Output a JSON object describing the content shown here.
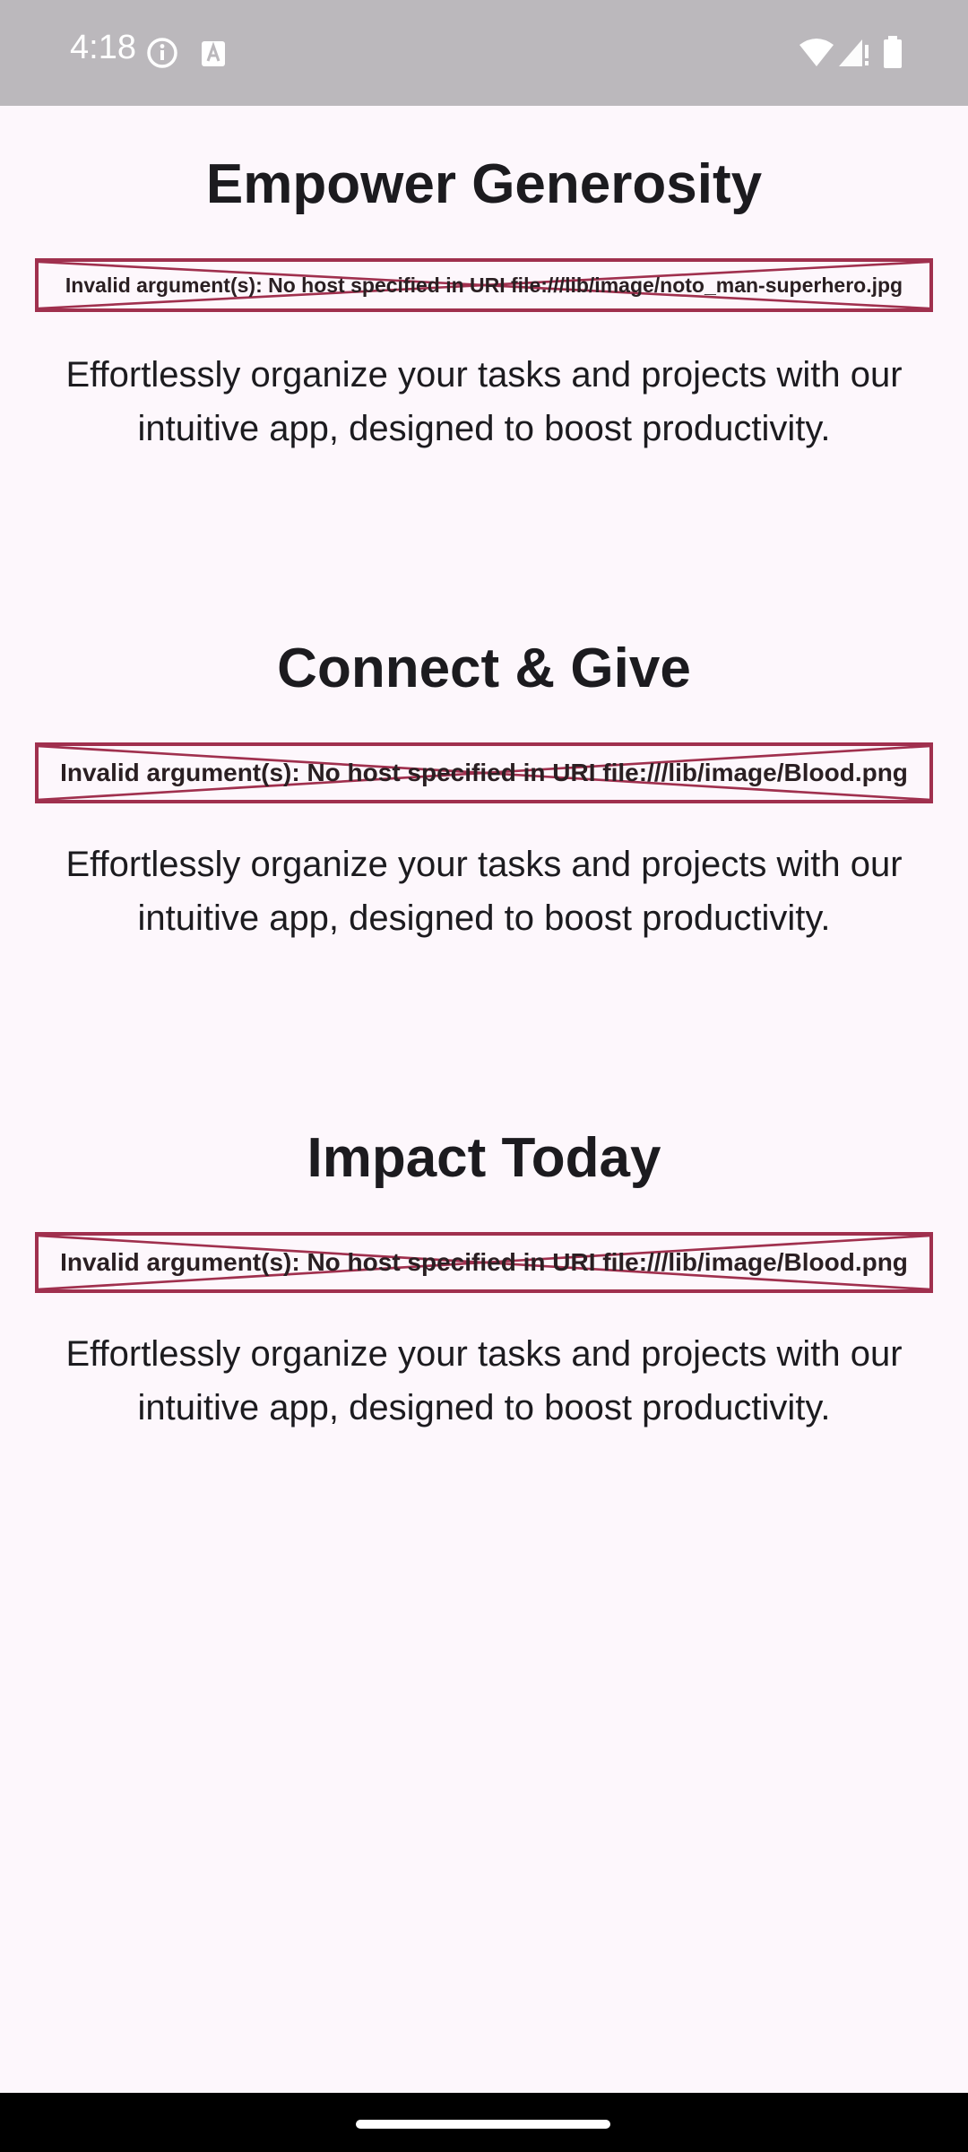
{
  "status_bar": {
    "time": "4:18",
    "icons": [
      "info-icon",
      "text-icon",
      "wifi-icon",
      "signal-icon",
      "battery-icon"
    ]
  },
  "sections": [
    {
      "title": "Empower Generosity",
      "image_error": "Invalid argument(s): No host specified in URI file:///lib/image/noto_man-superhero.jpg",
      "description": "Effortlessly organize your tasks and projects with our intuitive app, designed to boost productivity."
    },
    {
      "title": "Connect & Give",
      "image_error": "Invalid argument(s): No host specified in URI file:///lib/image/Blood.png",
      "description": "Effortlessly organize your tasks and projects with our intuitive app, designed to boost productivity."
    },
    {
      "title": "Impact Today",
      "image_error": "Invalid argument(s): No host specified in URI file:///lib/image/Blood.png",
      "description": "Effortlessly organize your tasks and projects with our intuitive app, designed to boost productivity."
    }
  ],
  "colors": {
    "background": "#fdf7fc",
    "status_bar": "#bbb8bc",
    "error_border": "#a0304e",
    "text": "#1c1b1f"
  }
}
